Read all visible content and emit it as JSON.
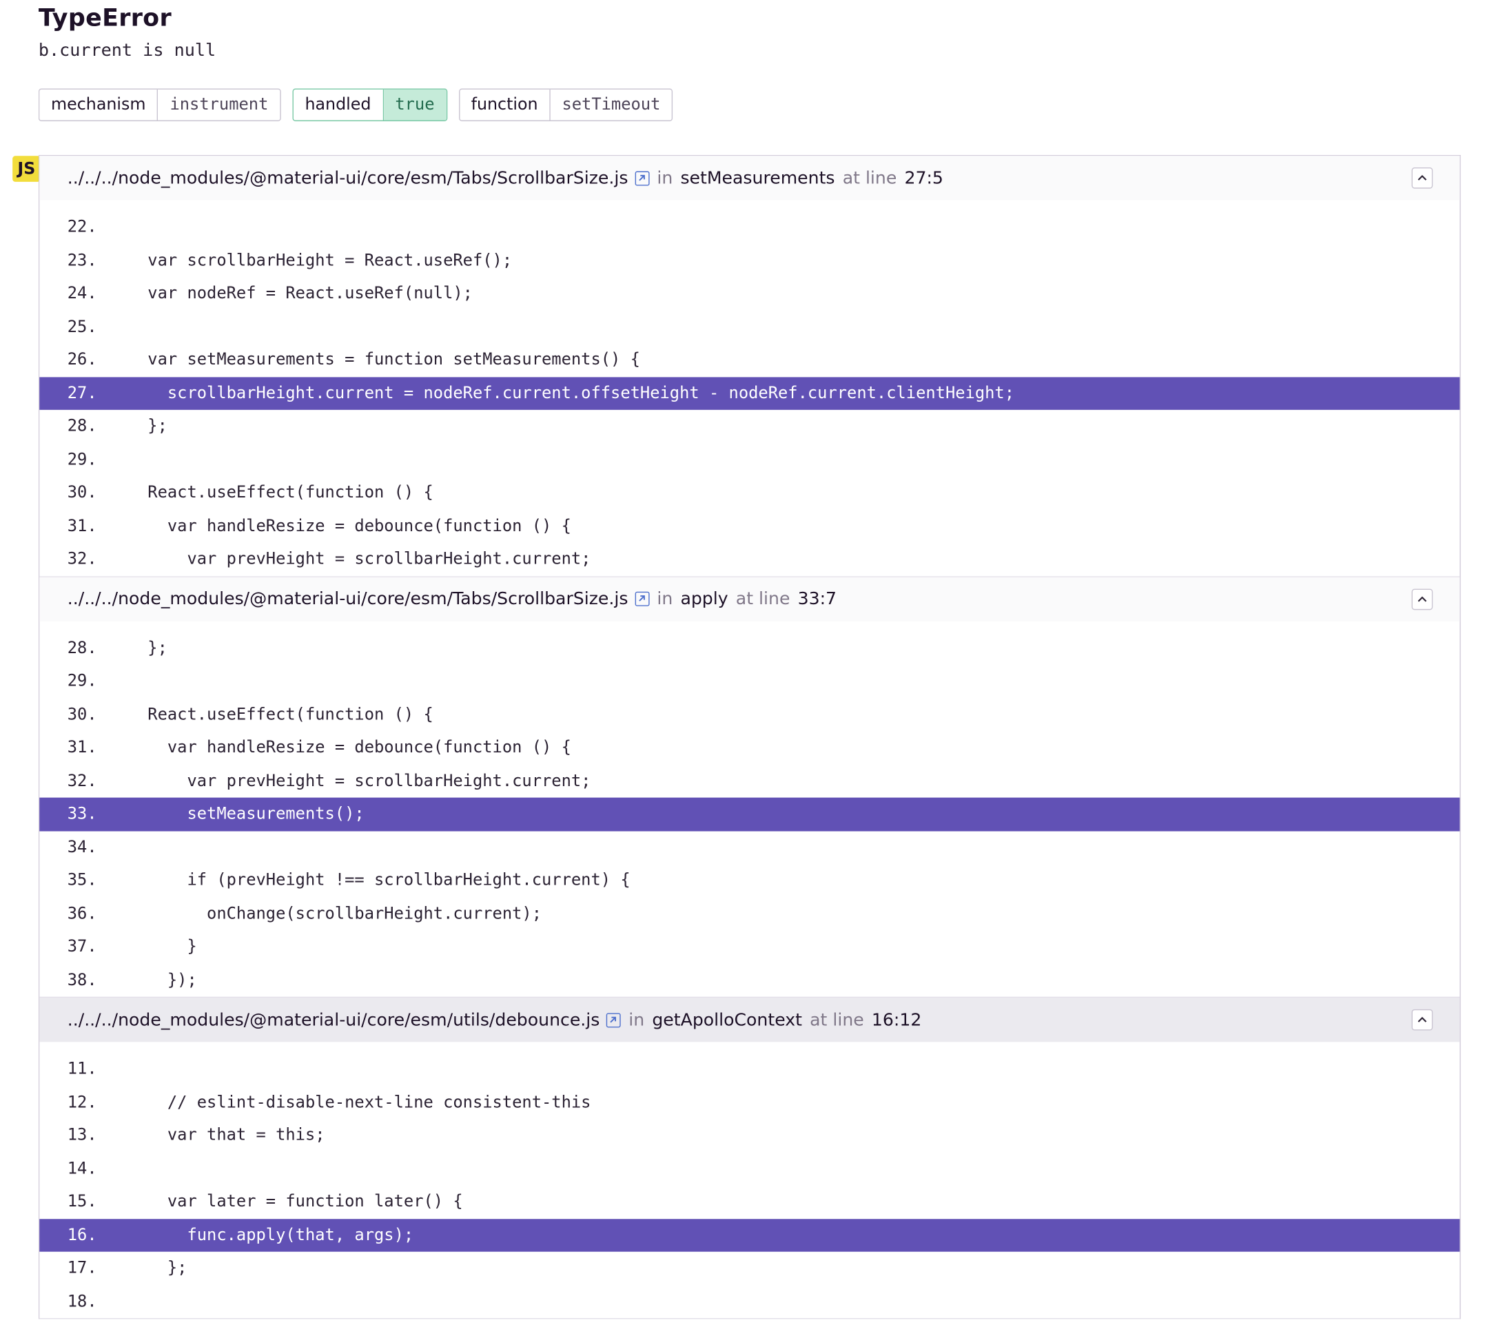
{
  "exception": {
    "type": "TypeError",
    "value": "b.current is null"
  },
  "tags": [
    {
      "key": "mechanism",
      "value": "instrument",
      "highlight": false
    },
    {
      "key": "handled",
      "value": "true",
      "highlight": true
    },
    {
      "key": "function",
      "value": "setTimeout",
      "highlight": false
    }
  ],
  "platform_badge": "JS",
  "frames": [
    {
      "file": "../../../node_modules/@material-ui/core/esm/Tabs/ScrollbarSize.js",
      "in_label": "in",
      "function": "setMeasurements",
      "at_line_label": "at line",
      "line": "27:5",
      "active": false,
      "lines": [
        {
          "num": "22.",
          "code": "",
          "hl": false
        },
        {
          "num": "23.",
          "code": "  var scrollbarHeight = React.useRef();",
          "hl": false
        },
        {
          "num": "24.",
          "code": "  var nodeRef = React.useRef(null);",
          "hl": false
        },
        {
          "num": "25.",
          "code": "",
          "hl": false
        },
        {
          "num": "26.",
          "code": "  var setMeasurements = function setMeasurements() {",
          "hl": false
        },
        {
          "num": "27.",
          "code": "    scrollbarHeight.current = nodeRef.current.offsetHeight - nodeRef.current.clientHeight;",
          "hl": true
        },
        {
          "num": "28.",
          "code": "  };",
          "hl": false
        },
        {
          "num": "29.",
          "code": "",
          "hl": false
        },
        {
          "num": "30.",
          "code": "  React.useEffect(function () {",
          "hl": false
        },
        {
          "num": "31.",
          "code": "    var handleResize = debounce(function () {",
          "hl": false
        },
        {
          "num": "32.",
          "code": "      var prevHeight = scrollbarHeight.current;",
          "hl": false
        }
      ]
    },
    {
      "file": "../../../node_modules/@material-ui/core/esm/Tabs/ScrollbarSize.js",
      "in_label": "in",
      "function": "apply",
      "at_line_label": "at line",
      "line": "33:7",
      "active": false,
      "lines": [
        {
          "num": "28.",
          "code": "  };",
          "hl": false
        },
        {
          "num": "29.",
          "code": "",
          "hl": false
        },
        {
          "num": "30.",
          "code": "  React.useEffect(function () {",
          "hl": false
        },
        {
          "num": "31.",
          "code": "    var handleResize = debounce(function () {",
          "hl": false
        },
        {
          "num": "32.",
          "code": "      var prevHeight = scrollbarHeight.current;",
          "hl": false
        },
        {
          "num": "33.",
          "code": "      setMeasurements();",
          "hl": true
        },
        {
          "num": "34.",
          "code": "",
          "hl": false
        },
        {
          "num": "35.",
          "code": "      if (prevHeight !== scrollbarHeight.current) {",
          "hl": false
        },
        {
          "num": "36.",
          "code": "        onChange(scrollbarHeight.current);",
          "hl": false
        },
        {
          "num": "37.",
          "code": "      }",
          "hl": false
        },
        {
          "num": "38.",
          "code": "    });",
          "hl": false
        }
      ]
    },
    {
      "file": "../../../node_modules/@material-ui/core/esm/utils/debounce.js",
      "in_label": "in",
      "function": "getApolloContext",
      "at_line_label": "at line",
      "line": "16:12",
      "active": true,
      "lines": [
        {
          "num": "11.",
          "code": "",
          "hl": false
        },
        {
          "num": "12.",
          "code": "    // eslint-disable-next-line consistent-this",
          "hl": false
        },
        {
          "num": "13.",
          "code": "    var that = this;",
          "hl": false
        },
        {
          "num": "14.",
          "code": "",
          "hl": false
        },
        {
          "num": "15.",
          "code": "    var later = function later() {",
          "hl": false
        },
        {
          "num": "16.",
          "code": "      func.apply(that, args);",
          "hl": true
        },
        {
          "num": "17.",
          "code": "    };",
          "hl": false
        },
        {
          "num": "18.",
          "code": "",
          "hl": false
        }
      ]
    }
  ],
  "icons": {
    "external_link": "external-link-icon",
    "collapse": "chevron-up-icon"
  },
  "colors": {
    "highlight_line": "#6151b5",
    "handled_true_bg": "#c5ebd9",
    "js_badge": "#f2dd3c",
    "link": "#4d6fcc"
  }
}
